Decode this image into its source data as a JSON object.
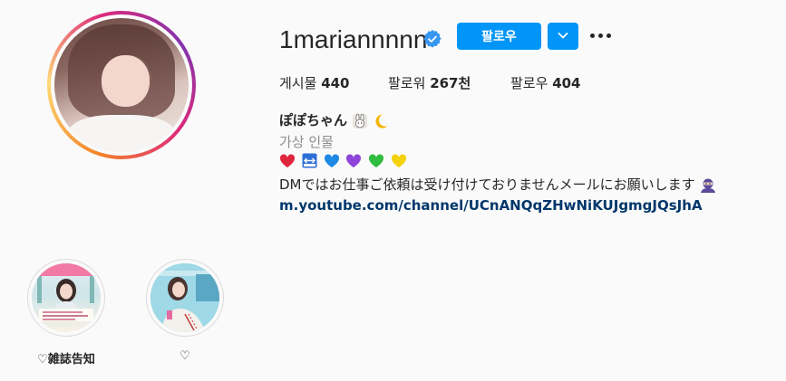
{
  "profile": {
    "username": "1mariannnnn",
    "verified": true,
    "follow_label": "팔로우",
    "posts_label": "게시물",
    "posts_count": "440",
    "followers_label": "팔로워",
    "followers_count": "267천",
    "following_label": "팔로우",
    "following_count": "404"
  },
  "bio": {
    "name": "ぽぽちゃん",
    "name_emojis": [
      "rabbit-icon",
      "crescent-moon-icon"
    ],
    "category": "가상 인물",
    "emoji_row": [
      "red-heart-icon",
      "left-right-arrow-icon",
      "blue-heart-icon",
      "purple-heart-icon",
      "green-heart-icon",
      "yellow-heart-icon"
    ],
    "text": "DMではお仕事ご依頼は受け付けておりませんメールにお願いします",
    "text_emoji": "ninja-icon",
    "link": "m.youtube.com/channel/UCnANQqZHwNiKUJgmgJQsJhA"
  },
  "highlights": [
    {
      "label": "♡雑誌告知"
    },
    {
      "label": "♡"
    }
  ],
  "colors": {
    "accent": "#0095f6",
    "link": "#00376b",
    "muted": "#8e8e8e",
    "text": "#262626"
  }
}
